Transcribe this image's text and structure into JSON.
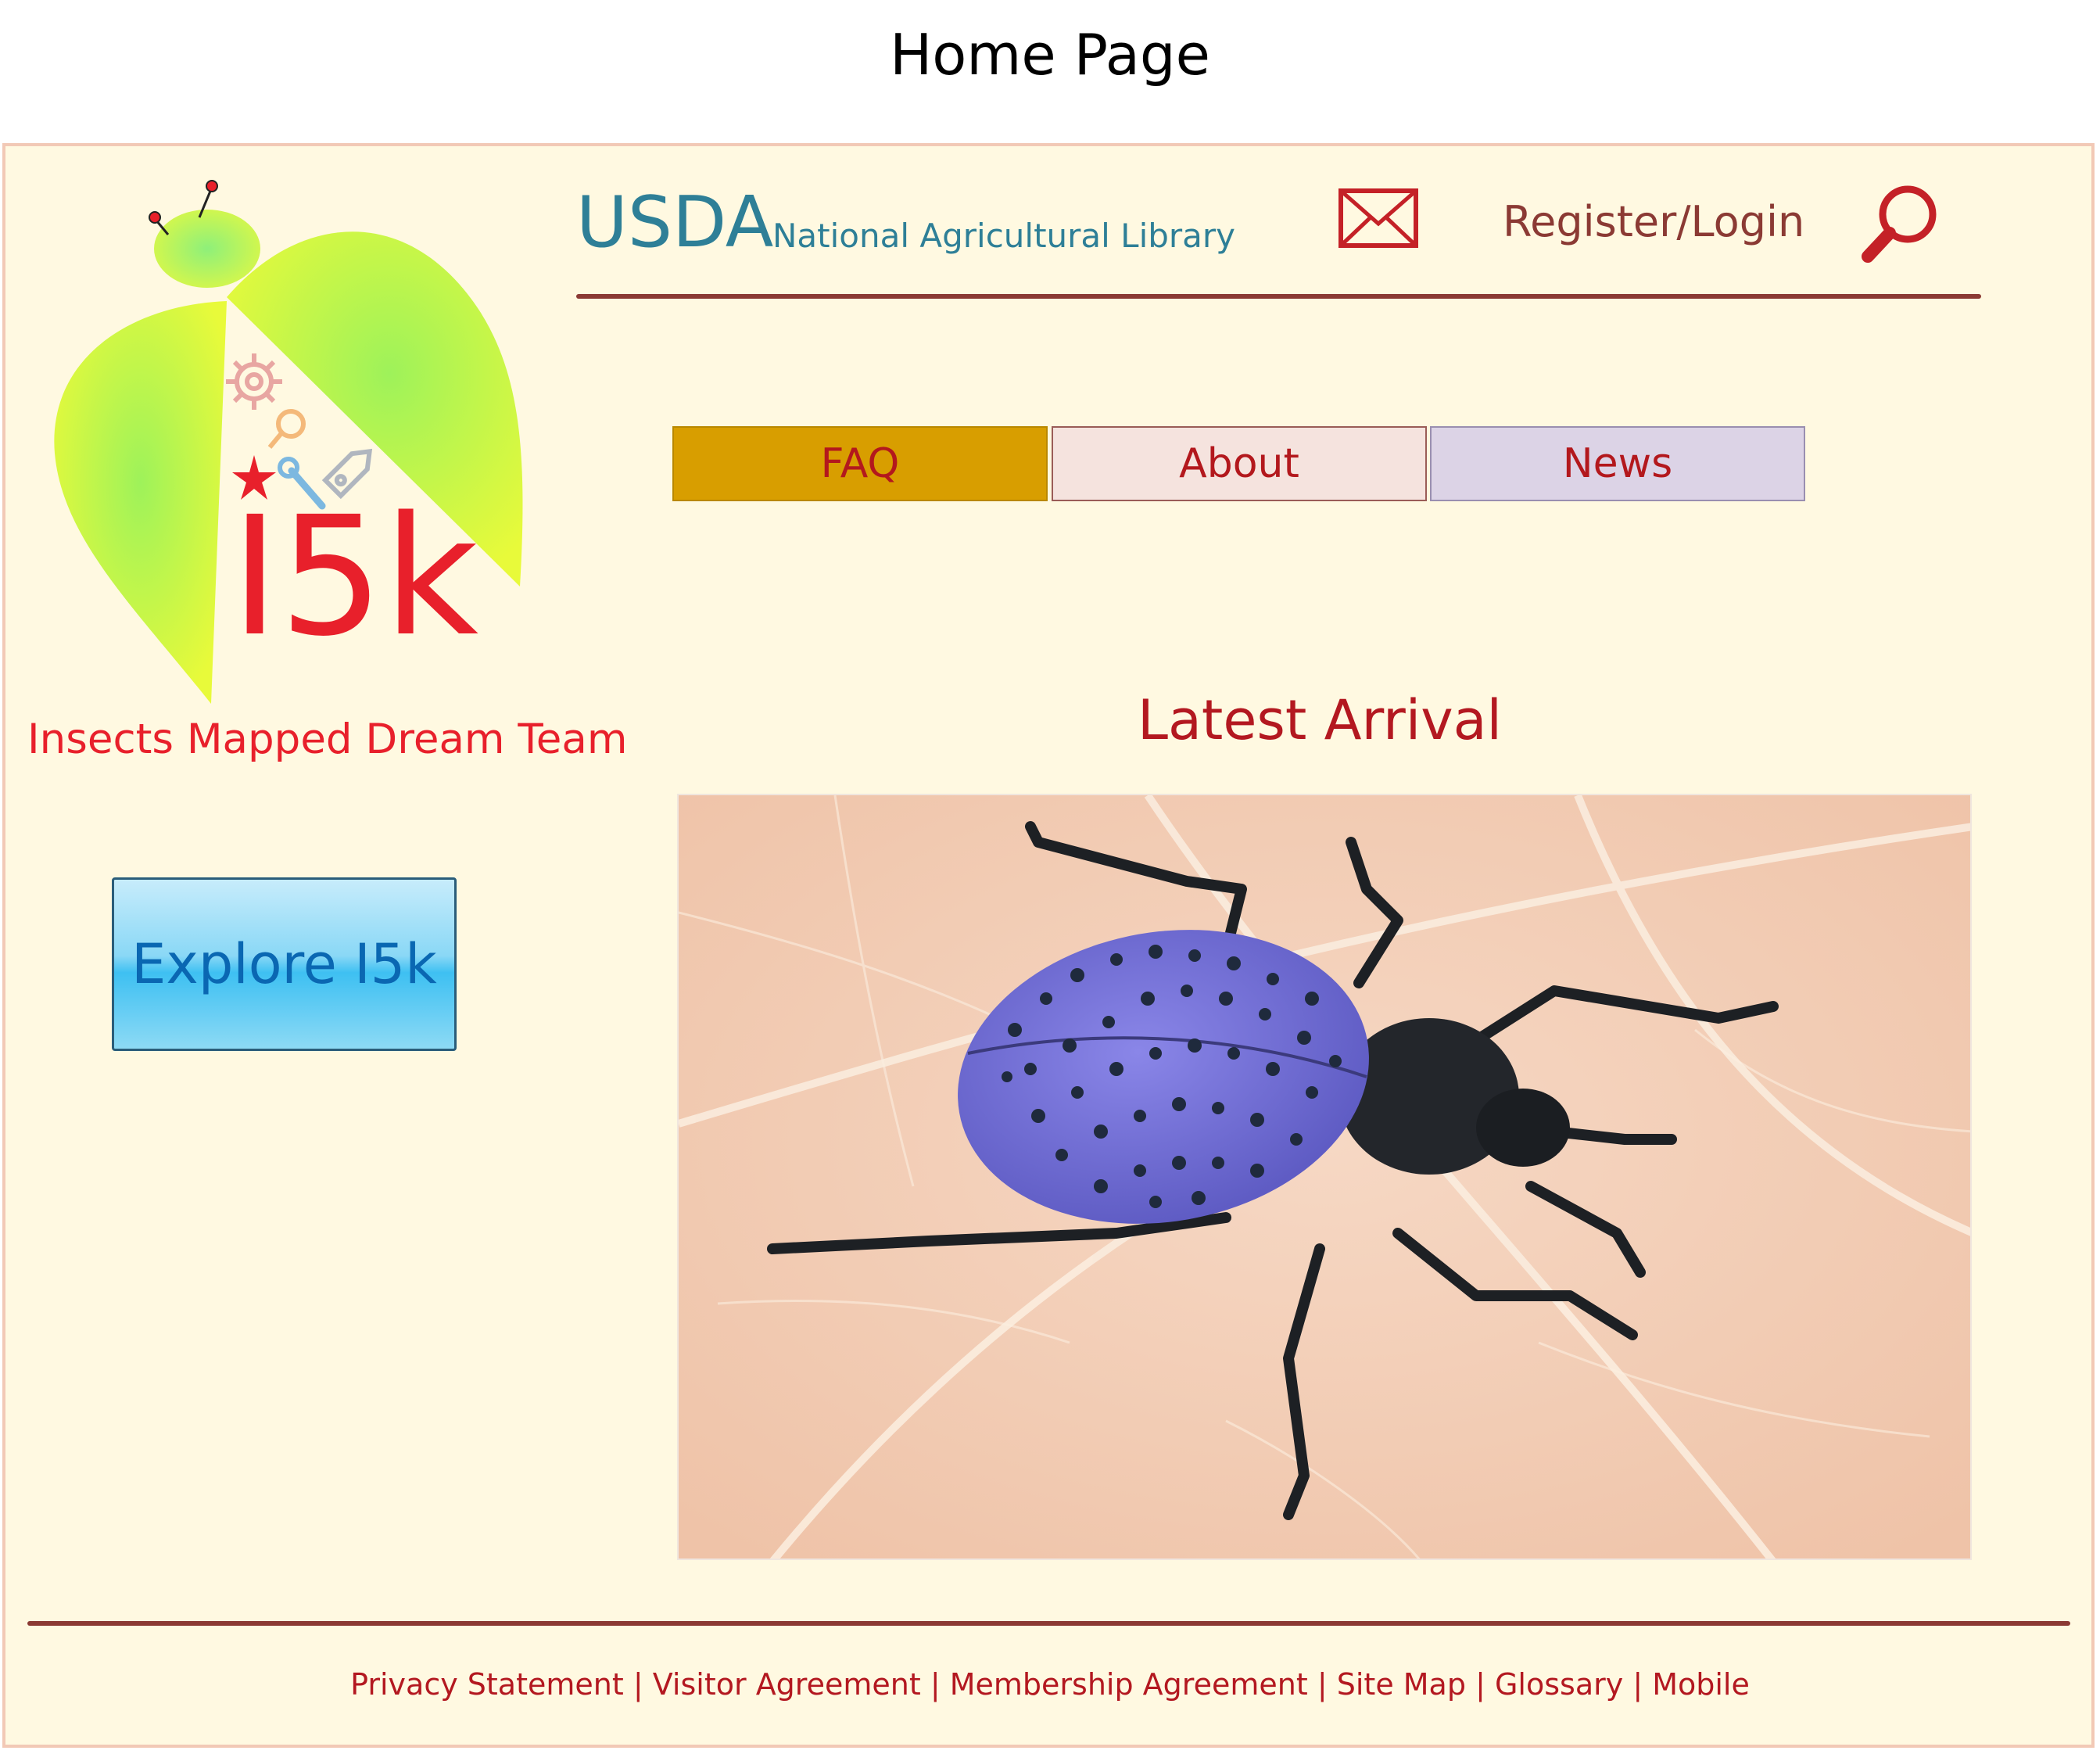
{
  "page_title": "Home Page",
  "logo": {
    "text": "I5k"
  },
  "tagline": "Insects Mapped Dream Team",
  "header": {
    "brand": "USDA",
    "brand_sub": "National Agricultural Library",
    "register_login": "Register/Login"
  },
  "tabs": [
    {
      "label": "FAQ",
      "color": "#d89e00"
    },
    {
      "label": "About",
      "color": "#f5e3de"
    },
    {
      "label": "News",
      "color": "#dcd3e6"
    }
  ],
  "latest_heading": "Latest Arrival",
  "explore_button": "Explore I5k",
  "footer_links": [
    "Privacy Statement",
    "Visitor Agreement",
    "Membership Agreement",
    "Site Map",
    "Glossary",
    "Mobile"
  ],
  "footer_separator": "|",
  "colors": {
    "page_bg": "#fff9e1",
    "accent_red": "#b31820",
    "rule": "#8b3a34",
    "usda_teal": "#2e7f97"
  }
}
